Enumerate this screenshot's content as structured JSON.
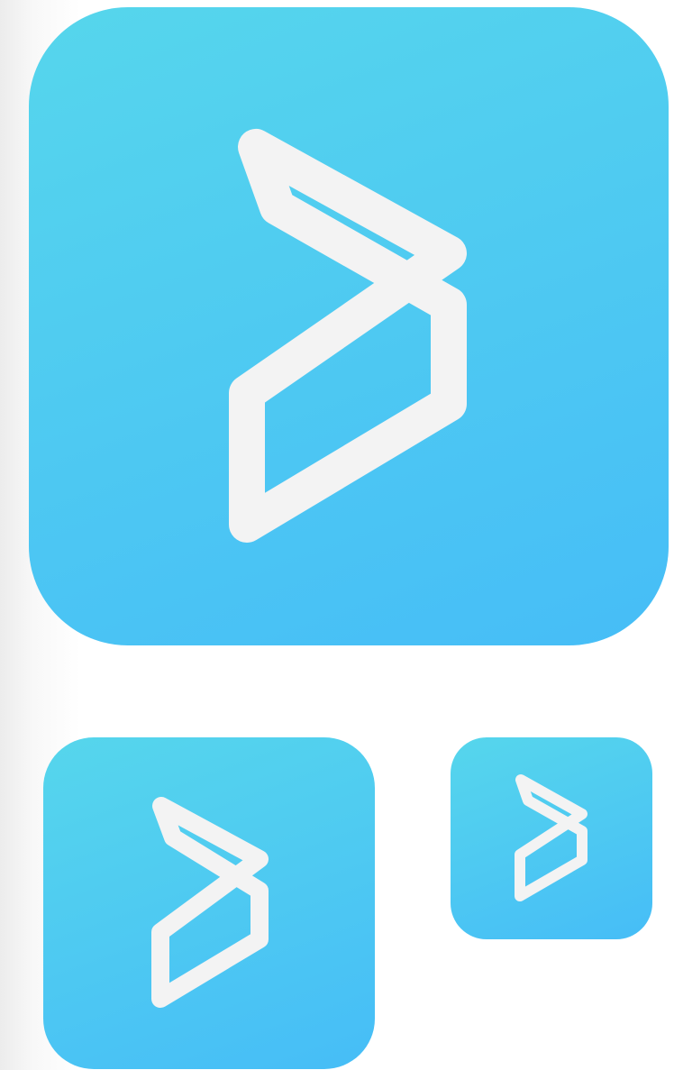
{
  "icons": [
    {
      "id": "large",
      "icon": "play-chevron-logo-icon"
    },
    {
      "id": "medium",
      "icon": "play-chevron-logo-icon"
    },
    {
      "id": "small",
      "icon": "play-chevron-logo-icon"
    }
  ],
  "colors": {
    "gradient_top": "#56d6ec",
    "gradient_bottom": "#46bdf7",
    "glyph": "#f3f3f3"
  }
}
